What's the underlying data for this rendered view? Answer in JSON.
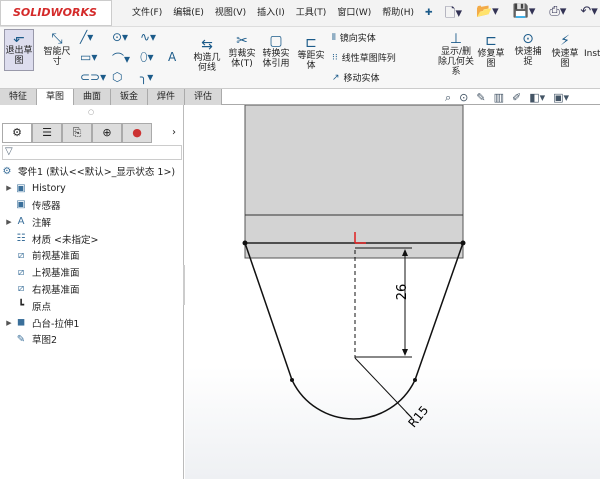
{
  "app": {
    "logo": "SOLIDWORKS"
  },
  "menu": [
    "文件(F)",
    "编辑(E)",
    "视图(V)",
    "插入(I)",
    "工具(T)",
    "窗口(W)",
    "帮助(H)"
  ],
  "ribbon": {
    "exit_sketch": "退出草图",
    "smart_dim": "智能尺寸",
    "construction": "构造几何线",
    "trim": "剪裁实体(T)",
    "convert": "转换实体引用",
    "offset": "等距实体",
    "mirror": "镜向实体",
    "linear_pattern": "线性草图阵列",
    "move": "移动实体",
    "display_relations": "显示/删除几何关系",
    "repair": "修复草图",
    "quick_snap": "快速捕捉",
    "rapid_sketch": "快速草图",
    "instant": "Inst"
  },
  "tabs": [
    "特征",
    "草图",
    "曲面",
    "钣金",
    "焊件",
    "评估"
  ],
  "active_tab": "草图",
  "tree": {
    "root": "零件1 (默认<<默认>_显示状态 1>)",
    "items": [
      {
        "label": "History",
        "arrow": true,
        "icon": "history-folder-icon"
      },
      {
        "label": "传感器",
        "arrow": false,
        "icon": "sensor-folder-icon"
      },
      {
        "label": "注解",
        "arrow": true,
        "icon": "annotation-folder-icon"
      },
      {
        "label": "材质 <未指定>",
        "arrow": false,
        "icon": "material-icon"
      },
      {
        "label": "前视基准面",
        "arrow": false,
        "icon": "plane-icon"
      },
      {
        "label": "上视基准面",
        "arrow": false,
        "icon": "plane-icon"
      },
      {
        "label": "右视基准面",
        "arrow": false,
        "icon": "plane-icon"
      },
      {
        "label": "原点",
        "arrow": false,
        "icon": "origin-icon"
      },
      {
        "label": "凸台-拉伸1",
        "arrow": true,
        "icon": "extrude-icon"
      },
      {
        "label": "草图2",
        "arrow": false,
        "icon": "sketch-icon"
      }
    ]
  },
  "drawing": {
    "dim_vertical": "26",
    "dim_radius": "R15"
  },
  "colors": {
    "accent": "#1c5b8a",
    "logo": "#d42a2a",
    "origin": "#e02020"
  }
}
